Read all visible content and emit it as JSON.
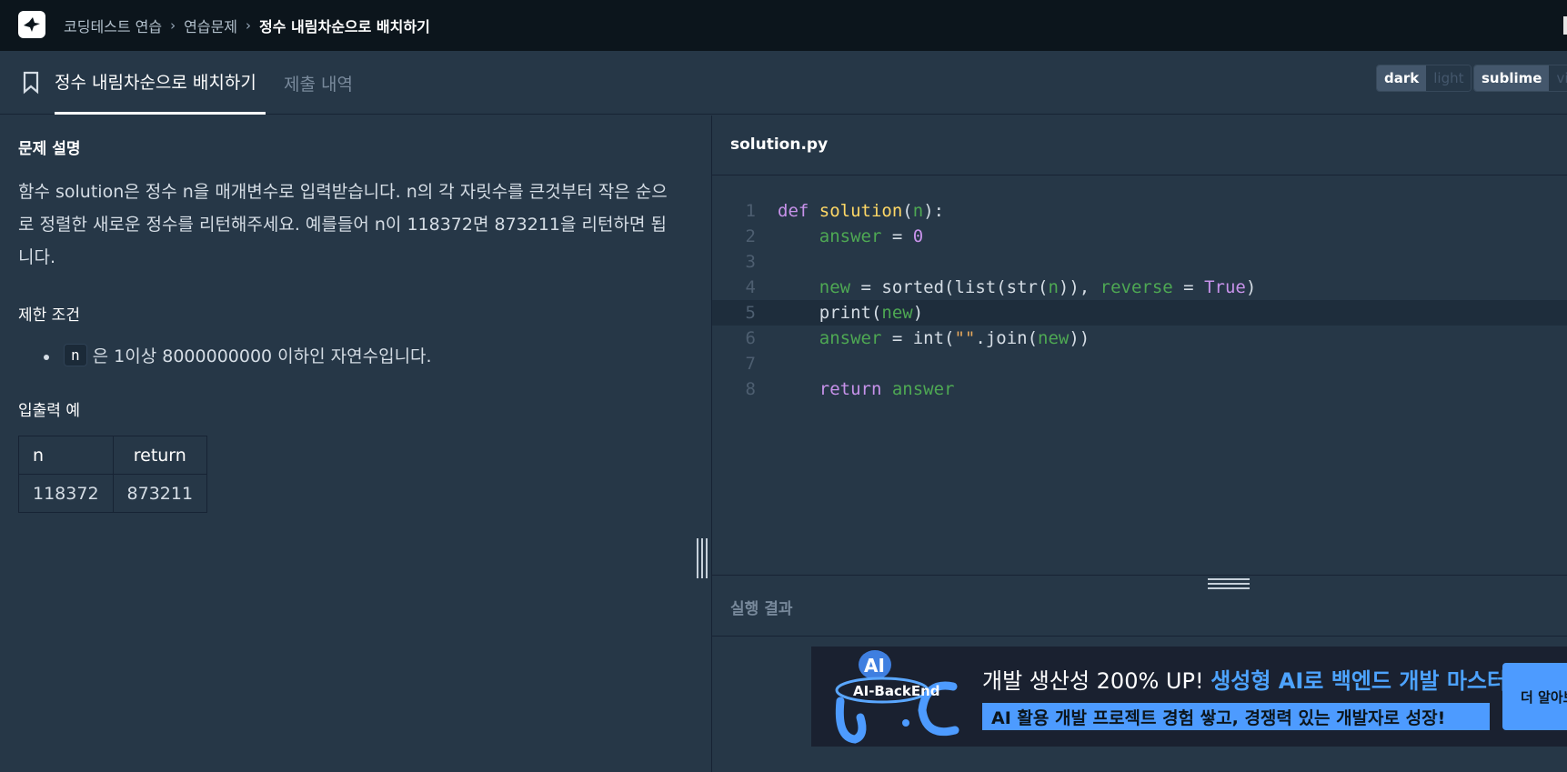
{
  "breadcrumb": {
    "items": [
      "코딩테스트 연습",
      "연습문제",
      "정수 내림차순으로 배치하기"
    ]
  },
  "tabs": {
    "active": "정수 내림차순으로 배치하기",
    "inactive": "제출 내역"
  },
  "theme_toggle": {
    "on": "dark",
    "off": "light"
  },
  "keymap_toggle": {
    "on": "sublime",
    "off": "vim"
  },
  "problem": {
    "description_title": "문제 설명",
    "description": "함수 solution은 정수 n을 매개변수로 입력받습니다. n의 각 자릿수를 큰것부터 작은 순으로 정렬한 새로운 정수를 리턴해주세요. 예를들어 n이 118372면 873211을 리턴하면 됩니다.",
    "constraints_title": "제한 조건",
    "constraint_code": "n",
    "constraint_text": "은 1이상 8000000000 이하인 자연수입니다.",
    "io_title": "입출력 예",
    "io_table": {
      "headers": [
        "n",
        "return"
      ],
      "rows": [
        [
          "118372",
          "873211"
        ]
      ]
    }
  },
  "editor": {
    "filename": "solution.py",
    "line_numbers": [
      "1",
      "2",
      "3",
      "4",
      "5",
      "6",
      "7",
      "8"
    ],
    "highlighted_line": 5
  },
  "result": {
    "label": "실행 결과"
  },
  "banner": {
    "logo_text": "AI-BackEnd",
    "headline_plain": "개발 생산성 200% UP! ",
    "headline_highlight": "생성형 AI로 백엔드 개발 마스터",
    "subline": "AI 활용 개발 프로젝트 경험 쌓고, 경쟁력 있는 개발자로 성장!",
    "button": "더 알아보기"
  },
  "colors": {
    "topbar": "#0c151c",
    "panel": "#263747",
    "accent": "#4d9bff"
  }
}
